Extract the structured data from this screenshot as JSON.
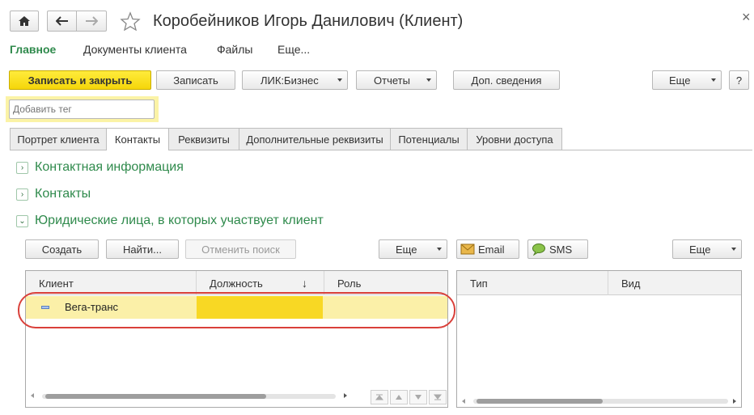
{
  "window": {
    "title": "Коробейников Игорь Данилович (Клиент)",
    "close_glyph": "×"
  },
  "topnav": {
    "items": [
      "Главное",
      "Документы клиента",
      "Файлы",
      "Еще..."
    ]
  },
  "toolbar": {
    "save_close": "Записать и закрыть",
    "save": "Записать",
    "lik": "ЛИК:Бизнес",
    "reports": "Отчеты",
    "extra_info": "Доп. сведения",
    "more": "Еще",
    "help": "?"
  },
  "tag": {
    "placeholder": "Добавить тег"
  },
  "tabs": [
    "Портрет клиента",
    "Контакты",
    "Реквизиты",
    "Дополнительные реквизиты",
    "Потенциалы",
    "Уровни доступа"
  ],
  "active_tab": "Контакты",
  "sections": {
    "contact_info": {
      "label": "Контактная информация",
      "expander": "›"
    },
    "contacts": {
      "label": "Контакты",
      "expander": "›"
    },
    "legal": {
      "label": "Юридические лица, в которых участвует клиент",
      "expander": "⌄"
    }
  },
  "left_toolbar": {
    "create": "Создать",
    "find": "Найти...",
    "cancel_search": "Отменить поиск",
    "more": "Еще"
  },
  "right_toolbar": {
    "email": "Email",
    "sms": "SMS",
    "more": "Еще"
  },
  "left_table": {
    "columns": [
      "Клиент",
      "Должность",
      "Роль"
    ],
    "sort_indicator": "↓",
    "rows": [
      {
        "client": "Вега-транс",
        "position": "",
        "role": ""
      }
    ]
  },
  "right_table": {
    "columns": [
      "Тип",
      "Вид"
    ]
  },
  "colors": {
    "accent_green": "#2f8a4c",
    "primary_yellow": "#f5d60a",
    "selection_row": "#fbf0a8",
    "annotation_red": "#d9403a"
  }
}
